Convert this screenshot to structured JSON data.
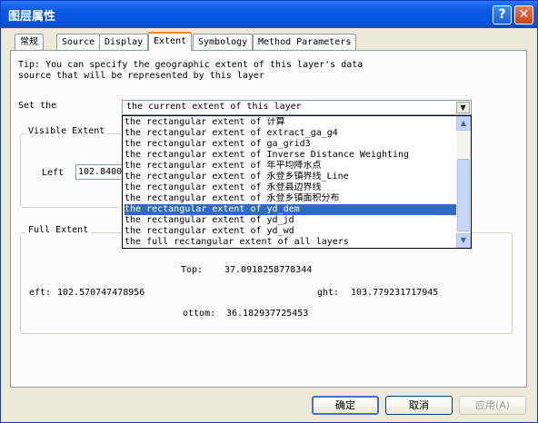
{
  "window": {
    "title": "图层属性",
    "help_label": "?",
    "close_label": "✕"
  },
  "tabs": [
    {
      "label": "常规"
    },
    {
      "label": "Source"
    },
    {
      "label": "Display"
    },
    {
      "label": "Extent"
    },
    {
      "label": "Symbology"
    },
    {
      "label": "Method Parameters"
    }
  ],
  "tip": "Tip:  You can specify the geographic extent of this layer's data source that will be represented by this layer",
  "set_the": {
    "label": "Set the",
    "value": "the current extent of this layer"
  },
  "dropdown": {
    "items": [
      "the rectangular extent of 计算",
      "the rectangular extent of extract_ga_g4",
      "the rectangular extent of ga_grid3",
      "the rectangular extent of Inverse Distance Weighting",
      "the rectangular extent of 年平均降水点",
      "the rectangular extent of 永登乡镇界线_Line",
      "the rectangular extent of 永登县边界线",
      "the rectangular extent of 永登乡镇面积分布",
      "the rectangular extent of yd_dem",
      "the rectangular extent of yd_jd",
      "the rectangular extent of yd_wd",
      "the full rectangular extent of all layers"
    ],
    "selected_index": 8,
    "scroll_up": "▲",
    "scroll_down": "▼"
  },
  "visible_extent": {
    "label": "Visible Extent",
    "left_label": "Left",
    "left_value": "102.8400"
  },
  "full_extent": {
    "label": "Full Extent",
    "top_label": "Top:",
    "top_value": "37.0918258778344",
    "left_label": "eft:",
    "left_value": "102.570747478956",
    "right_label": "ght:",
    "right_value": "103.779231717945",
    "bottom_label": "ottom:",
    "bottom_value": "36.182937725453"
  },
  "buttons": {
    "ok": "确定",
    "cancel": "取消",
    "apply": "应用(A)"
  },
  "colors": {
    "titlebar": "#0a58e6",
    "selection": "#316ac5",
    "tab_accent": "#e68b2c"
  }
}
